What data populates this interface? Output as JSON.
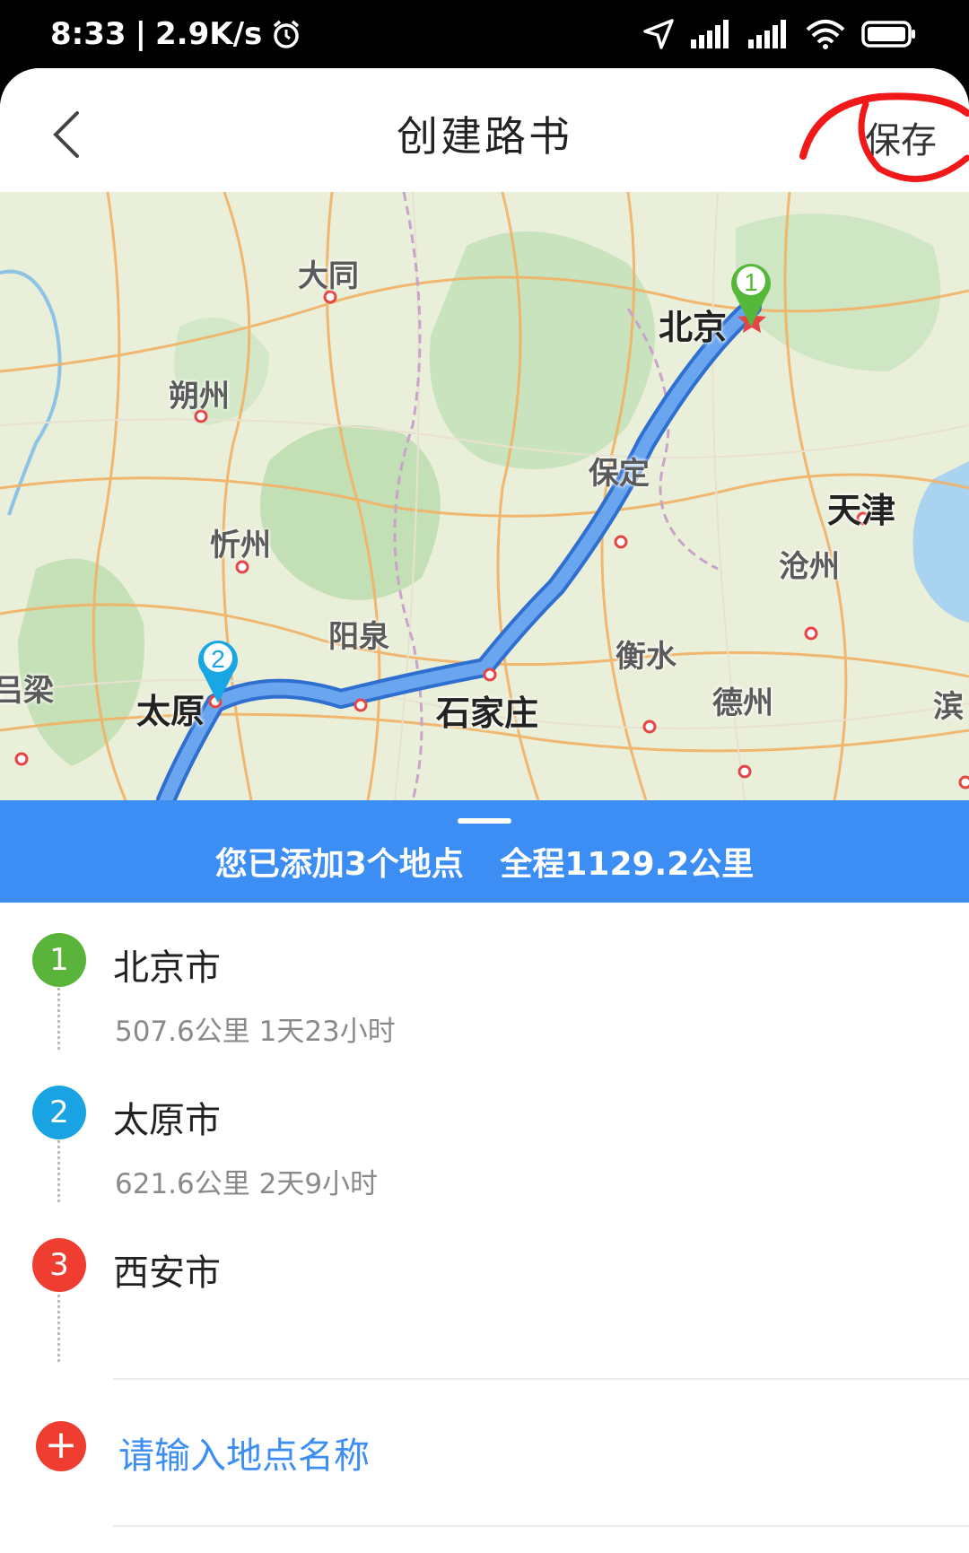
{
  "status_bar": {
    "time": "8:33",
    "speed": "2.9K/s",
    "icons": [
      "alarm-icon",
      "location-arrow-icon",
      "signal-icon",
      "signal-icon",
      "wifi-icon",
      "battery-icon"
    ]
  },
  "header": {
    "title": "创建路书",
    "save_label": "保存",
    "back_icon": "chevron-left-icon"
  },
  "map": {
    "cities": {
      "datong": "大同",
      "shuozhou": "朔州",
      "xinzhou": "忻州",
      "taiyuan": "太原",
      "yangquan": "阳泉",
      "shijiazhuang": "石家庄",
      "baoding": "保定",
      "beijing": "北京",
      "tianjin": "天津",
      "cangzhou": "沧州",
      "hengshui": "衡水",
      "dezhou": "德州",
      "lvliang": "吕梁",
      "binzhou": "滨"
    },
    "pins": [
      {
        "number": "1",
        "color": "#55b83a"
      },
      {
        "number": "2",
        "color": "#19a6e4"
      }
    ],
    "route_color": "#4a90e2"
  },
  "summary": {
    "added": "您已添加3个地点",
    "total": "全程1129.2公里"
  },
  "waypoints": [
    {
      "number": "1",
      "name": "北京市",
      "meta": "507.6公里  1天23小时",
      "color": "#5ab33a"
    },
    {
      "number": "2",
      "name": "太原市",
      "meta": "621.6公里  2天9小时",
      "color": "#1aa3e3"
    },
    {
      "number": "3",
      "name": "西安市",
      "meta": "",
      "color": "#ef3d32"
    }
  ],
  "add_place": {
    "placeholder": "请输入地点名称",
    "icon": "plus-icon"
  }
}
